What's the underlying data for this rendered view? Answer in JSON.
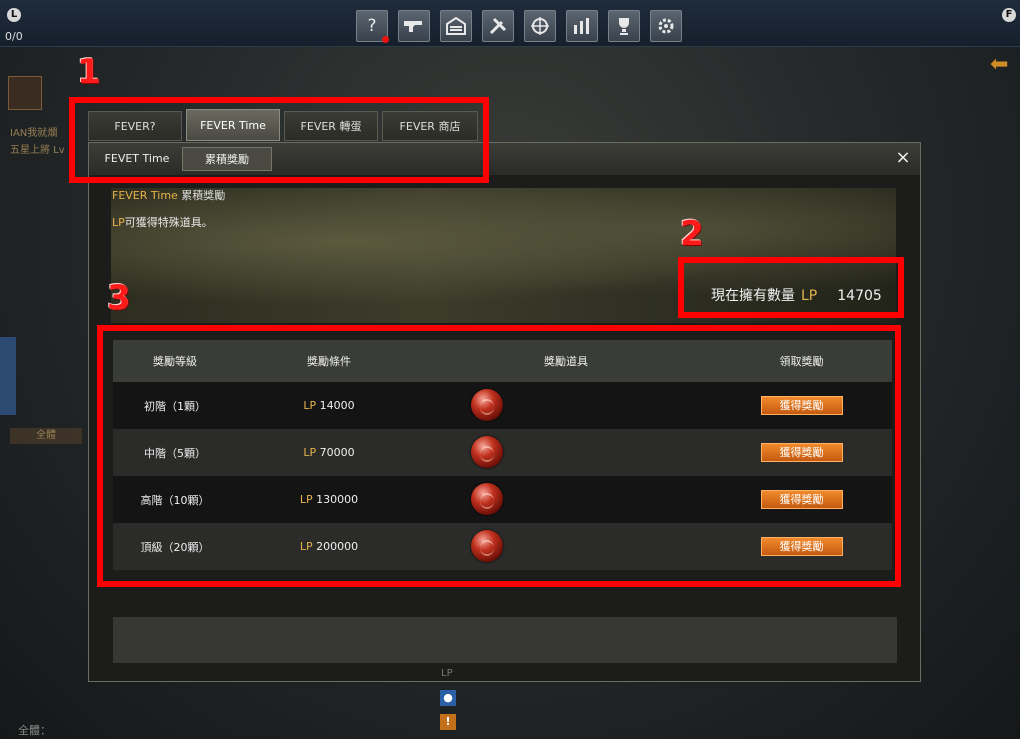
{
  "topbar": {
    "left_badge": "L",
    "right_badge": "F",
    "counter": "0/0",
    "icons": [
      "help-icon",
      "gun-icon",
      "warehouse-icon",
      "tools-icon",
      "crosshair-icon",
      "stats-icon",
      "trophy-icon",
      "settings-icon"
    ]
  },
  "left_panel": {
    "name_text": "IAN我就爛",
    "rank_text": "五星上將 Lv",
    "all_button": "全體",
    "bottom_text": "全體："
  },
  "tabs": [
    {
      "label": "FEVER?"
    },
    {
      "label": "FEVER Time",
      "active": true
    },
    {
      "label": "FEVER 轉蛋"
    },
    {
      "label": "FEVER 商店"
    }
  ],
  "subtabs": [
    {
      "label": "FEVET Time"
    },
    {
      "label": "累積獎勵",
      "active": true
    }
  ],
  "panel": {
    "close_icon": "×",
    "banner_title_gold": "FEVER Time",
    "banner_title_rest": " 累積獎勵",
    "banner_sub_gold": "LP",
    "banner_sub_rest": "可獲得特殊道具。",
    "balance_label": "現在擁有數量",
    "balance_currency": "LP",
    "balance_value": "14705"
  },
  "table": {
    "headers": [
      "獎勵等級",
      "獎勵條件",
      "獎勵道具",
      "領取獎勵"
    ],
    "rows": [
      {
        "level": "初階（1顆）",
        "currency": "LP",
        "requirement": "14000",
        "button": "獲得獎勵"
      },
      {
        "level": "中階（5顆）",
        "currency": "LP",
        "requirement": "70000",
        "button": "獲得獎勵"
      },
      {
        "level": "高階（10顆）",
        "currency": "LP",
        "requirement": "130000",
        "button": "獲得獎勵"
      },
      {
        "level": "頂級（20顆）",
        "currency": "LP",
        "requirement": "200000",
        "button": "獲得獎勵"
      }
    ]
  },
  "annotations": {
    "marker1": "1",
    "marker2": "2",
    "marker3": "3",
    "color": "#ff0000"
  },
  "bottom": {
    "lp_label": "LP",
    "user_icon": "user-icon",
    "warning_icon": "warning-icon"
  }
}
